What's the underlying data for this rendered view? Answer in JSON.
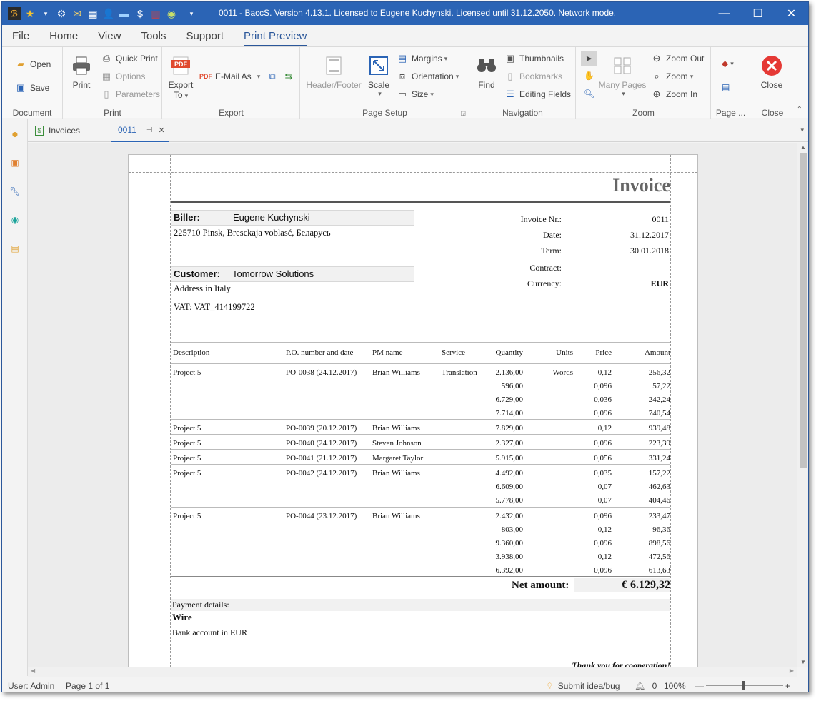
{
  "window": {
    "title": "0011 - BaccS. Version 4.13.1. Licensed to Eugene Kuchynski. Licensed until 31.12.2050. Network mode."
  },
  "menu": {
    "tabs": [
      "File",
      "Home",
      "View",
      "Tools",
      "Support",
      "Print Preview"
    ]
  },
  "ribbon": {
    "document": {
      "label": "Document",
      "open": "Open",
      "save": "Save"
    },
    "print": {
      "label": "Print",
      "print": "Print",
      "quick_print": "Quick Print",
      "options": "Options",
      "parameters": "Parameters"
    },
    "export": {
      "label": "Export",
      "export_to_1": "Export",
      "export_to_2": "To",
      "email_as": "E-Mail As"
    },
    "page_setup": {
      "label": "Page Setup",
      "header_footer": "Header/Footer",
      "scale": "Scale",
      "margins": "Margins",
      "orientation": "Orientation",
      "size": "Size"
    },
    "navigation": {
      "label": "Navigation",
      "find": "Find",
      "thumbnails": "Thumbnails",
      "bookmarks": "Bookmarks",
      "editing_fields": "Editing Fields"
    },
    "zoom": {
      "label": "Zoom",
      "many_pages": "Many Pages",
      "zoom_out": "Zoom Out",
      "zoom": "Zoom",
      "zoom_in": "Zoom In"
    },
    "page": {
      "label": "Page ..."
    },
    "close": {
      "label": "Close",
      "close": "Close"
    }
  },
  "doc_tabs": [
    {
      "label": "Invoices"
    },
    {
      "label": "0011"
    }
  ],
  "invoice": {
    "title": "Invoice",
    "biller_label": "Biller:",
    "biller_name": "Eugene Kuchynski",
    "biller_address": "225710 Pinsk, Bresckaja voblasć, Беларусь",
    "customer_label": "Customer:",
    "customer_name": "Tomorrow Solutions",
    "customer_address": "Address in Italy",
    "customer_vat": "VAT: VAT_414199722",
    "meta": [
      {
        "label": "Invoice Nr.:",
        "value": "0011"
      },
      {
        "label": "Date:",
        "value": "31.12.2017"
      },
      {
        "label": "Term:",
        "value": "30.01.2018"
      },
      {
        "label": "Contract:",
        "value": ""
      },
      {
        "label": "Currency:",
        "value": "EUR"
      }
    ],
    "columns": [
      "Description",
      "P.O. number and date",
      "PM name",
      "Service",
      "Quantity",
      "Units",
      "Price",
      "Amount"
    ],
    "rows": [
      [
        "Project 5",
        "PO-0038 (24.12.2017)",
        "Brian Williams",
        "Translation",
        "2.136,00",
        "Words",
        "0,12",
        "256,32"
      ],
      [
        "",
        "",
        "",
        "",
        "596,00",
        "",
        "0,096",
        "57,22"
      ],
      [
        "",
        "",
        "",
        "",
        "6.729,00",
        "",
        "0,036",
        "242,24"
      ],
      [
        "",
        "",
        "",
        "",
        "7.714,00",
        "",
        "0,096",
        "740,54"
      ],
      [
        "Project 5",
        "PO-0039 (20.12.2017)",
        "Brian Williams",
        "",
        "7.829,00",
        "",
        "0,12",
        "939,48"
      ],
      [
        "Project 5",
        "PO-0040 (24.12.2017)",
        "Steven Johnson",
        "",
        "2.327,00",
        "",
        "0,096",
        "223,39"
      ],
      [
        "Project 5",
        "PO-0041 (21.12.2017)",
        "Margaret Taylor",
        "",
        "5.915,00",
        "",
        "0,056",
        "331,24"
      ],
      [
        "Project 5",
        "PO-0042 (24.12.2017)",
        "Brian Williams",
        "",
        "4.492,00",
        "",
        "0,035",
        "157,22"
      ],
      [
        "",
        "",
        "",
        "",
        "6.609,00",
        "",
        "0,07",
        "462,63"
      ],
      [
        "",
        "",
        "",
        "",
        "5.778,00",
        "",
        "0,07",
        "404,46"
      ],
      [
        "Project 5",
        "PO-0044 (23.12.2017)",
        "Brian Williams",
        "",
        "2.432,00",
        "",
        "0,096",
        "233,47"
      ],
      [
        "",
        "",
        "",
        "",
        "803,00",
        "",
        "0,12",
        "96,36"
      ],
      [
        "",
        "",
        "",
        "",
        "9.360,00",
        "",
        "0,096",
        "898,56"
      ],
      [
        "",
        "",
        "",
        "",
        "3.938,00",
        "",
        "0,12",
        "472,56"
      ],
      [
        "",
        "",
        "",
        "",
        "6.392,00",
        "",
        "0,096",
        "613,63"
      ]
    ],
    "net_amount_label": "Net amount:",
    "net_amount_value": "€ 6.129,32",
    "payment_details_label": "Payment details:",
    "payment_method": "Wire",
    "bank_account": "Bank account in EUR",
    "thanks": "Thank you for cooperation!"
  },
  "status": {
    "user": "User: Admin",
    "page": "Page 1 of 1",
    "submit": "Submit idea/bug",
    "notifications": "0",
    "zoom": "100%"
  },
  "colors": {
    "title_bar": "#2b64b5",
    "accent": "#2b579a"
  }
}
